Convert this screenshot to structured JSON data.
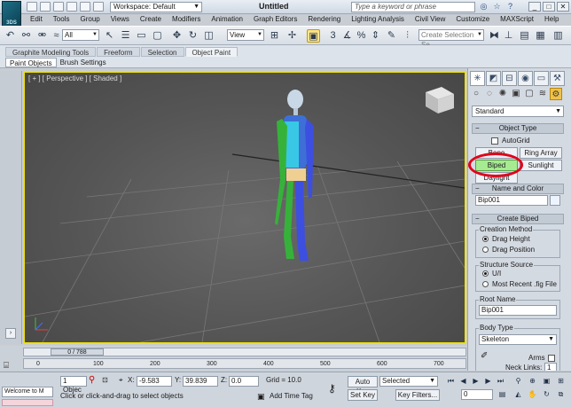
{
  "titlebar": {
    "logo_text": "3DS",
    "workspace": "Workspace: Default",
    "doc_title": "Untitled",
    "help_search_placeholder": "Type a keyword or phrase",
    "help_icons": [
      "binoculars-icon",
      "star-icon",
      "help-icon"
    ],
    "window_controls": [
      "_",
      "□",
      "✕"
    ]
  },
  "menu": [
    "Edit",
    "Tools",
    "Group",
    "Views",
    "Create",
    "Modifiers",
    "Animation",
    "Graph Editors",
    "Rendering",
    "Lighting Analysis",
    "Civil View",
    "Customize",
    "MAXScript",
    "Help"
  ],
  "toolbar": {
    "selection_filter": "All",
    "ref_coord": "View",
    "selection_set_placeholder": "Create Selection Se"
  },
  "ribbon": {
    "tabs": [
      "Graphite Modeling Tools",
      "Freeform",
      "Selection",
      "Object Paint"
    ],
    "active_tab": "Object Paint",
    "subtabs": [
      "Paint Objects",
      "Brush Settings"
    ]
  },
  "viewport": {
    "label": "[ + ] [ Perspective ] [ Shaded ]",
    "border_color": "#f0e000"
  },
  "command_panel": {
    "category": "Standard",
    "object_type": {
      "title": "Object Type",
      "autogrid_label": "AutoGrid",
      "buttons": [
        "Bone",
        "Ring Array",
        "Biped",
        "Sunlight",
        "Daylight"
      ]
    },
    "name_and_color": {
      "title": "Name and Color",
      "name_value": "Bip001"
    },
    "create_biped": {
      "title": "Create Biped",
      "creation_method_label": "Creation Method",
      "creation_methods": [
        "Drag Height",
        "Drag Position"
      ],
      "structure_source_label": "Structure Source",
      "structure_sources": [
        "U/I",
        "Most Recent .fig File"
      ],
      "root_name_label": "Root Name",
      "root_name_value": "Bip001",
      "body_type_label": "Body Type",
      "body_type_value": "Skeleton",
      "arms_label": "Arms",
      "neck_links_label": "Neck Links:",
      "neck_links_value": "1"
    },
    "highlight_color": "#e0001a"
  },
  "timeline": {
    "frame_display": "0 / 788",
    "ruler_ticks": [
      "0",
      "100",
      "200",
      "300",
      "400",
      "500",
      "600",
      "700"
    ]
  },
  "status": {
    "listener_text": "Welcome to M",
    "selection_count": "1 Objec",
    "x_label": "X:",
    "x_value": "-9.583",
    "y_label": "Y:",
    "y_value": "39.839",
    "z_label": "Z:",
    "z_value": "0.0",
    "grid": "Grid = 10.0",
    "prompt": "Click or click-and-drag to select objects",
    "add_time_tag": "Add Time Tag",
    "auto_key": "Auto Key",
    "set_key": "Set Key",
    "key_mode": "Selected",
    "key_filters": "Key Filters...",
    "frame_value": "0"
  }
}
